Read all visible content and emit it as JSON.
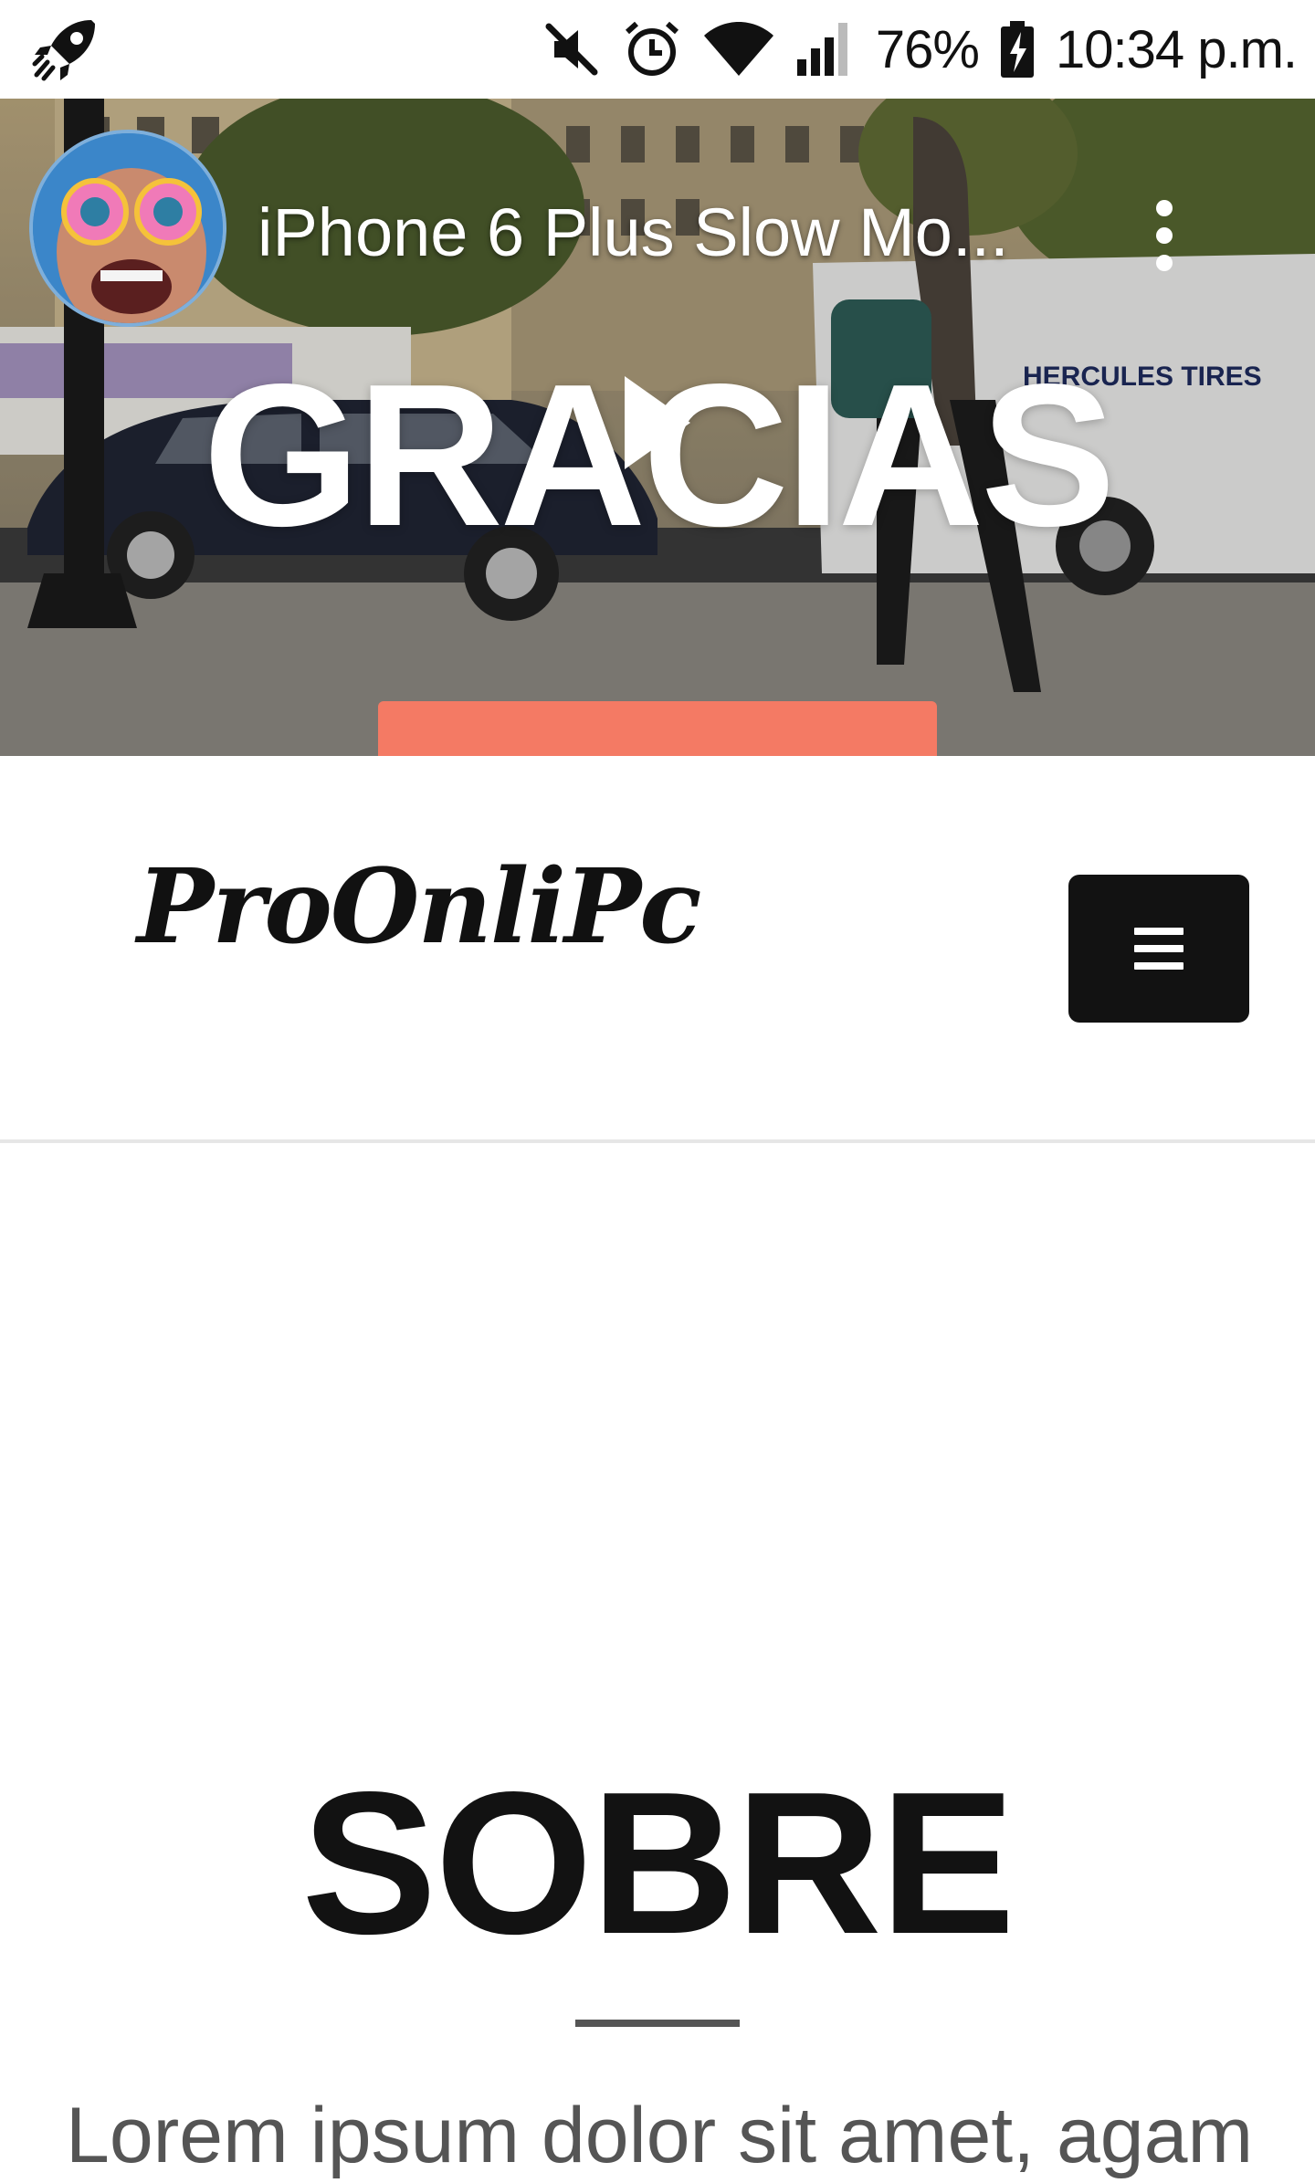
{
  "status_bar": {
    "battery": "76%",
    "time": "10:34 p.m.",
    "icons": [
      "rocket-icon",
      "mute-icon",
      "alarm-icon",
      "wifi-icon",
      "signal-icon",
      "battery-charging-icon"
    ]
  },
  "video": {
    "title": "iPhone 6 Plus Slow Mo...",
    "overlay_text": "GRACIAS",
    "menu_icon": "more-vert-icon",
    "play_icon": "play-icon",
    "accent_color": "#f47a64"
  },
  "site_header": {
    "logo_text": "ProOnliPc",
    "menu_icon": "hamburger-icon"
  },
  "about": {
    "title": "SOBRE",
    "text": "Lorem ipsum dolor sit amet, agam"
  }
}
